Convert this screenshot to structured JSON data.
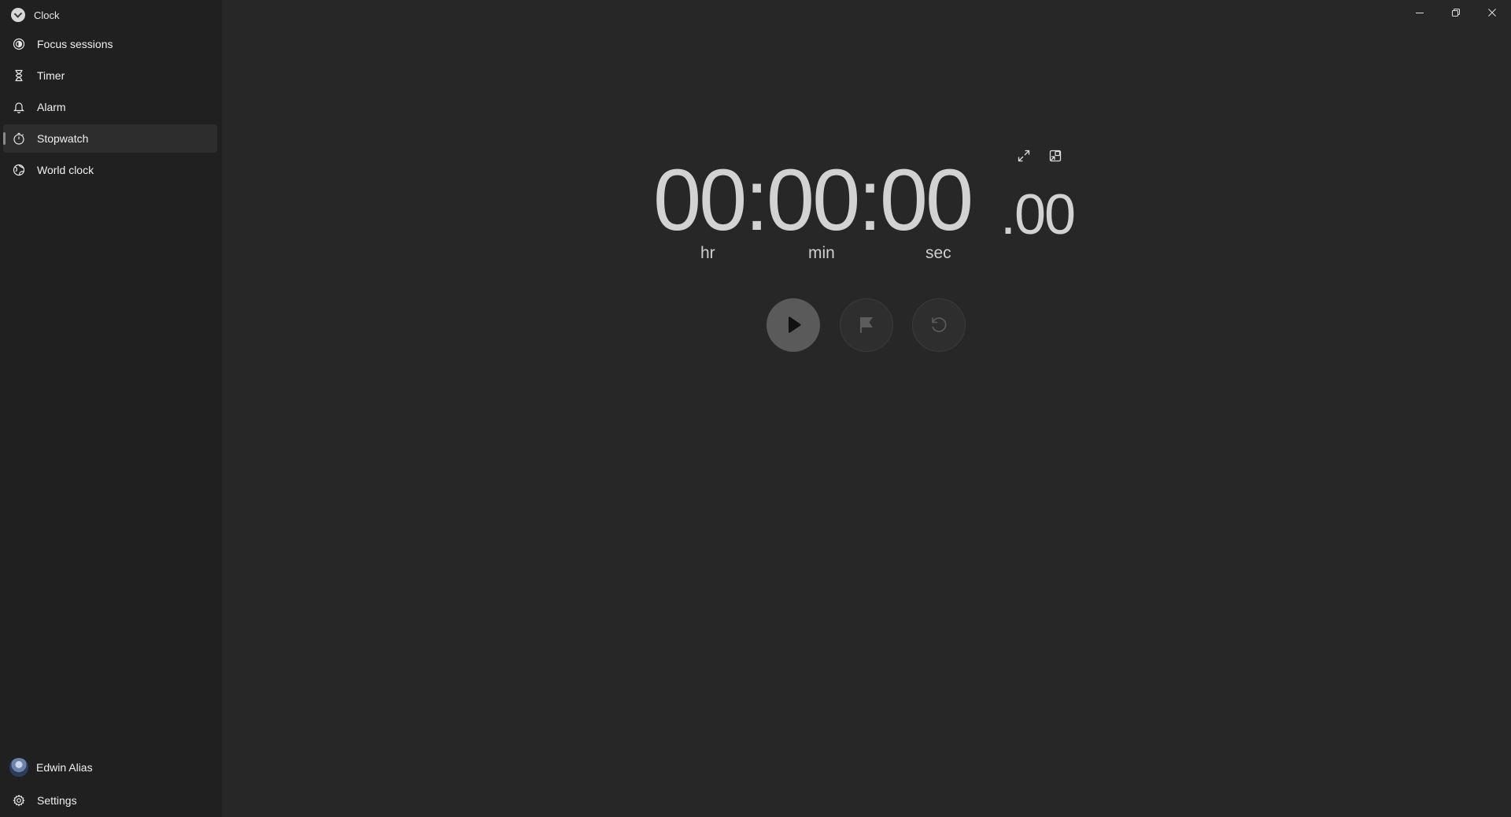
{
  "app": {
    "title": "Clock",
    "icon": "clock-app-icon"
  },
  "sidebar": {
    "items": [
      {
        "label": "Focus sessions",
        "icon": "focus-icon"
      },
      {
        "label": "Timer",
        "icon": "hourglass-icon"
      },
      {
        "label": "Alarm",
        "icon": "bell-icon"
      },
      {
        "label": "Stopwatch",
        "icon": "stopwatch-icon",
        "selected": true
      },
      {
        "label": "World clock",
        "icon": "globe-icon"
      }
    ],
    "profile": {
      "name": "Edwin Alias",
      "icon": "avatar"
    },
    "settings": {
      "label": "Settings",
      "icon": "gear-icon"
    }
  },
  "window_controls": {
    "minimize": "minimize-icon",
    "restore": "restore-icon",
    "close": "close-icon"
  },
  "stopwatch": {
    "time_main": "00:00:00",
    "time_frac": ".00",
    "units": {
      "hr": "hr",
      "min": "min",
      "sec": "sec"
    },
    "tools": {
      "expand": "expand-icon",
      "compact_overlay": "compact-overlay-icon"
    },
    "controls": {
      "start": "play-icon",
      "lap": "flag-icon",
      "reset": "reset-icon"
    }
  },
  "colors": {
    "background": "#272727",
    "sidebar_background": "#202020",
    "text": "#f0f0f0",
    "digits": "#d2d2d2",
    "primary_button": "#5a5a5a",
    "secondary_button": "#2e2e2e"
  }
}
